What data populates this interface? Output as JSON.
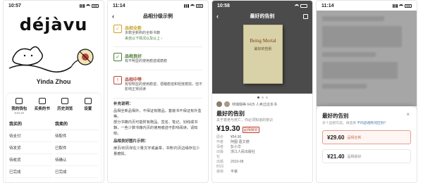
{
  "panel1": {
    "time": "10:57",
    "logo": "déjàvu",
    "username": "Yinda Zhou",
    "quick": [
      {
        "label": "我的钱包",
        "sub": "¥19.20",
        "icon": "wallet-icon"
      },
      {
        "label": "买卖的书",
        "sub": "",
        "icon": "books-icon"
      },
      {
        "label": "历史浏览",
        "sub": "",
        "icon": "history-icon"
      },
      {
        "label": "设置",
        "sub": "",
        "icon": "gear-icon"
      }
    ],
    "left_header": "我买的",
    "left_items": [
      "待支付",
      "待发货",
      "待收货",
      "已完成"
    ],
    "right_header": "我卖的",
    "right_items": [
      "待取件",
      "已取件",
      "待确认",
      "已完成"
    ]
  },
  "panel2": {
    "time": "11:14",
    "title": "品相分级示例",
    "grades": [
      {
        "name": "品相全新",
        "desc": "多数全新购的全新书籍",
        "link": "来自以下情况以及以上 ›",
        "color": "#c9a227",
        "mark": "✓"
      },
      {
        "name": "品相良好",
        "desc": "有不明显的使用痕迹或磨痕",
        "link": "",
        "color": "#4a7a34",
        "mark": "✓"
      },
      {
        "name": "品相中等",
        "desc": "有较明显的使用痕迹、褶皱痕迹和轻度磨损，但不影响正常阅读",
        "link": "",
        "color": "#b5473a",
        "mark": "!"
      }
    ],
    "note_title": "补充说明：",
    "note_1": "品相全新品相外，不保证有赠品，套装书不保证有外盒等。",
    "note_2": "部分书籍内页可能附有赠品、签名、笔记、划线或书籍，一些少数书籍内页的使用痕迹不影响阅读，请知晓。",
    "section_title": "品相良好图片示例：",
    "section_text": "扉页/封页存在少量文字或盖章，书脊/内页边缘存在少量磨损。"
  },
  "panel3": {
    "time": "10:58",
    "title": "最好的告别",
    "cover_title": "Being Mortal",
    "cover_sub": "最好的告别",
    "seller_text": "林璐璐等 6425 人卖过这本书",
    "book_title": "最好的告别",
    "book_sub": "关于衰老与死亡，你必须知道的常识",
    "price": "¥19.30",
    "price_tag": "品相良好",
    "meta": [
      {
        "k": "原价",
        "v": "¥54.90"
      },
      {
        "k": "作者",
        "v": "阿图·葛文德"
      },
      {
        "k": "译者",
        "v": "彭小华"
      },
      {
        "k": "出版社",
        "v": "浙江人民出版社"
      },
      {
        "k": "出版时间",
        "v": "2015-08"
      },
      {
        "k": "装帧",
        "v": "平装"
      }
    ]
  },
  "panel4": {
    "time": "11:14",
    "sheet_title": "最好的告别",
    "sheet_sub": "多个品相可选，请选择",
    "sheet_link": "不同品相有何区别？",
    "close": "×",
    "options": [
      {
        "price": "¥29.60",
        "grade": "品相全新",
        "selected": true
      },
      {
        "price": "¥21.40",
        "grade": "品相良好",
        "selected": false
      }
    ]
  }
}
